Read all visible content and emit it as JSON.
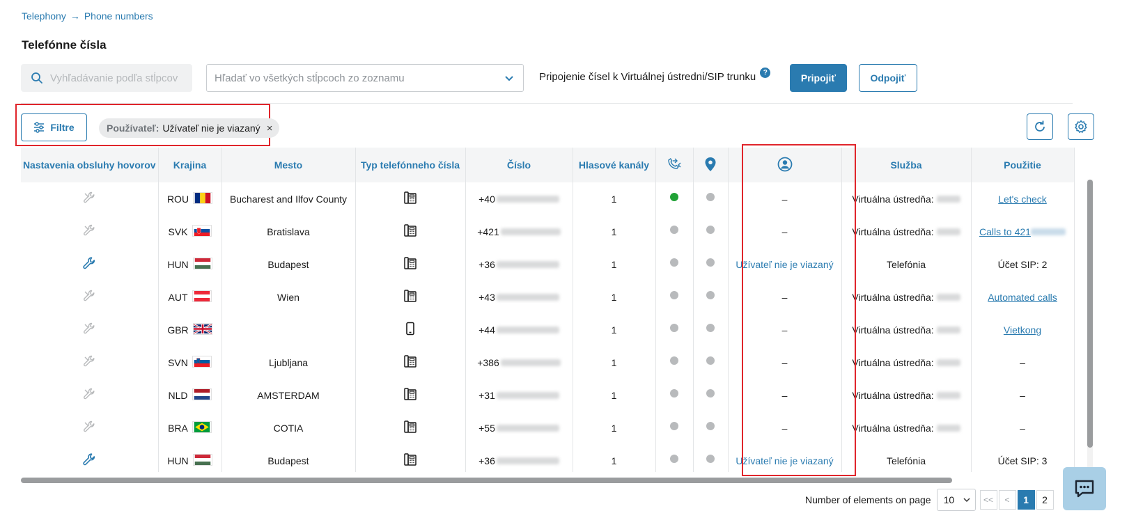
{
  "breadcrumb": {
    "items": [
      "Telephony",
      "Phone numbers"
    ],
    "separator": "→"
  },
  "page_title": "Telefónne čísla",
  "search": {
    "placeholder": "Vyhľadávanie podľa stĺpcov"
  },
  "column_select": {
    "placeholder": "Hľadať vo všetkých stĺpcoch zo zoznamu"
  },
  "connect": {
    "text": "Pripojenie čísel k Virtuálnej ústredni/SIP trunku",
    "help": "?",
    "connect_label": "Pripojiť",
    "disconnect_label": "Odpojiť"
  },
  "filters": {
    "button_label": "Filtre",
    "chip_key": "Používateľ:",
    "chip_value": "Užívateľ nie je viazaný",
    "chip_remove": "×"
  },
  "table": {
    "headers": {
      "call_settings": "Nastavenia obsluhy hovorov",
      "country": "Krajina",
      "city": "Mesto",
      "number_type": "Typ telefónneho čísla",
      "number": "Číslo",
      "voice_channels": "Hlasové kanály",
      "forwarding": "call-forward-icon",
      "location": "location-pin-icon",
      "user": "user-circle-icon",
      "service": "Služba",
      "usage": "Použitie"
    },
    "rows": [
      {
        "settings_active": false,
        "country": "ROU",
        "flag": "ROU",
        "city": "Bucharest and Ilfov County",
        "type": "landline",
        "prefix": "+40",
        "channels": "1",
        "fwd_status": "active",
        "loc_status": "inactive",
        "user": "–",
        "user_link": false,
        "service": "Virtuálna ústredňa:",
        "service_blur": true,
        "usage": "Let's check",
        "usage_link": true,
        "usage_blur": false
      },
      {
        "settings_active": false,
        "country": "SVK",
        "flag": "SVK",
        "city": "Bratislava",
        "type": "landline",
        "prefix": "+421",
        "channels": "1",
        "fwd_status": "inactive",
        "loc_status": "inactive",
        "user": "–",
        "user_link": false,
        "service": "Virtuálna ústredňa:",
        "service_blur": true,
        "usage": "Calls to 421",
        "usage_link": true,
        "usage_blur": true
      },
      {
        "settings_active": true,
        "country": "HUN",
        "flag": "HUN",
        "city": "Budapest",
        "type": "landline",
        "prefix": "+36",
        "channels": "1",
        "fwd_status": "inactive",
        "loc_status": "inactive",
        "user": "Užívateľ nie je viazaný",
        "user_link": true,
        "service": "Telefónia",
        "service_blur": false,
        "usage": "Účet SIP: 2",
        "usage_link": false,
        "usage_blur": false
      },
      {
        "settings_active": false,
        "country": "AUT",
        "flag": "AUT",
        "city": "Wien",
        "type": "landline",
        "prefix": "+43",
        "channels": "1",
        "fwd_status": "inactive",
        "loc_status": "inactive",
        "user": "–",
        "user_link": false,
        "service": "Virtuálna ústredňa:",
        "service_blur": true,
        "usage": "Automated calls",
        "usage_link": true,
        "usage_blur": false
      },
      {
        "settings_active": false,
        "country": "GBR",
        "flag": "GBR",
        "city": "",
        "type": "mobile",
        "prefix": "+44",
        "channels": "1",
        "fwd_status": "inactive",
        "loc_status": "inactive",
        "user": "–",
        "user_link": false,
        "service": "Virtuálna ústredňa:",
        "service_blur": true,
        "usage": "Vietkong",
        "usage_link": true,
        "usage_blur": false
      },
      {
        "settings_active": false,
        "country": "SVN",
        "flag": "SVN",
        "city": "Ljubljana",
        "type": "landline",
        "prefix": "+386",
        "channels": "1",
        "fwd_status": "inactive",
        "loc_status": "inactive",
        "user": "–",
        "user_link": false,
        "service": "Virtuálna ústredňa:",
        "service_blur": true,
        "usage": "–",
        "usage_link": false,
        "usage_blur": false
      },
      {
        "settings_active": false,
        "country": "NLD",
        "flag": "NLD",
        "city": "AMSTERDAM",
        "type": "landline",
        "prefix": "+31",
        "channels": "1",
        "fwd_status": "inactive",
        "loc_status": "inactive",
        "user": "–",
        "user_link": false,
        "service": "Virtuálna ústredňa:",
        "service_blur": true,
        "usage": "–",
        "usage_link": false,
        "usage_blur": false
      },
      {
        "settings_active": false,
        "country": "BRA",
        "flag": "BRA",
        "city": "COTIA",
        "type": "landline",
        "prefix": "+55",
        "channels": "1",
        "fwd_status": "inactive",
        "loc_status": "inactive",
        "user": "–",
        "user_link": false,
        "service": "Virtuálna ústredňa:",
        "service_blur": true,
        "usage": "–",
        "usage_link": false,
        "usage_blur": false
      },
      {
        "settings_active": true,
        "country": "HUN",
        "flag": "HUN",
        "city": "Budapest",
        "type": "landline",
        "prefix": "+36",
        "channels": "1",
        "fwd_status": "inactive",
        "loc_status": "inactive",
        "user": "Užívateľ nie je viazaný",
        "user_link": true,
        "service": "Telefónia",
        "service_blur": false,
        "usage": "Účet SIP: 3",
        "usage_link": false,
        "usage_blur": false
      }
    ]
  },
  "pagination": {
    "label": "Number of elements on page",
    "page_size": "10",
    "first": "<<",
    "prev": "<",
    "pages": [
      "1",
      "2"
    ],
    "current": "1"
  },
  "colors": {
    "accent": "#2a7bb0",
    "highlight": "#e0252b",
    "status_active": "#21a236",
    "status_inactive": "#b8babc"
  },
  "icons": {
    "chat": "chat-bubble-icon",
    "refresh": "refresh-icon",
    "settings": "gear-icon",
    "filter": "sliders-icon",
    "search": "search-icon"
  }
}
